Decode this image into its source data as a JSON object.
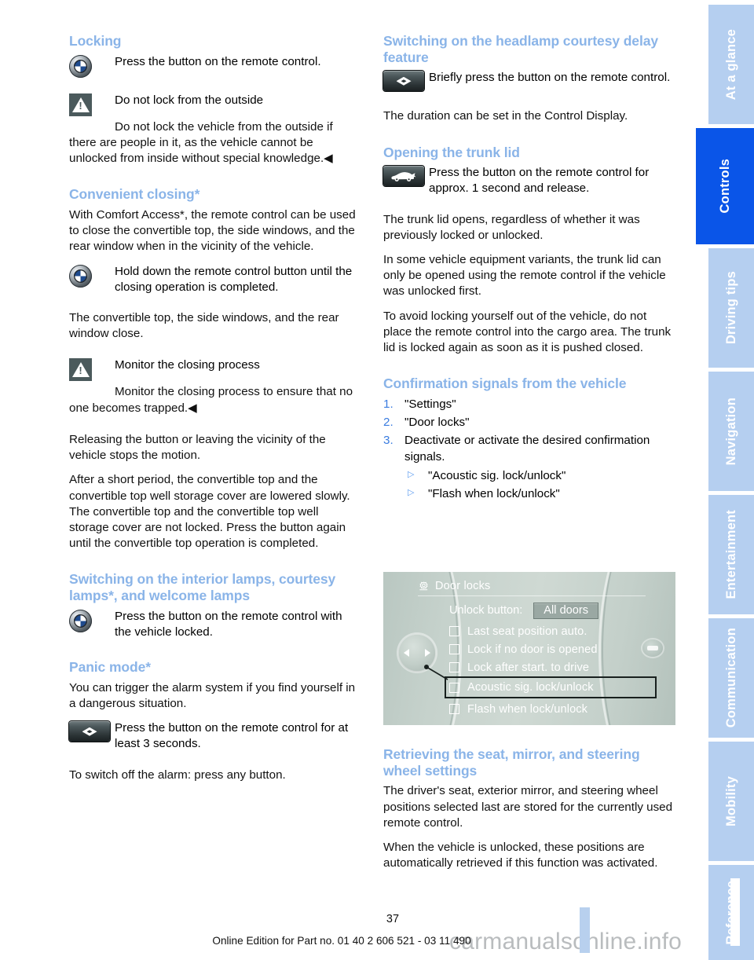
{
  "document": {
    "page_number": "37",
    "footer": "Online Edition for Part no. 01 40 2 606 521 - 03 11 490",
    "watermark": "carmanualsonline.info"
  },
  "colors": {
    "heading_blue": "#8ab4e8",
    "tab_inactive": "#b5cff0",
    "tab_active": "#0a55e8",
    "list_number_blue": "#3b7de0"
  },
  "left_column": {
    "locking": {
      "heading": "Locking",
      "remote_instruction": "Press the button on the remote control.",
      "warning_title": "Do not lock from the outside",
      "warning_body": "Do not lock the vehicle from the outside if there are people in it, as the vehicle cannot be unlocked from inside without special knowledge.◀"
    },
    "convenient_closing": {
      "heading": "Convenient closing*",
      "p1": "With Comfort Access*, the remote control can be used to close the convertible top, the side windows, and the rear window when in the vicinity of the vehicle.",
      "remote_instruction": "Hold down the remote control button until the closing operation is completed.",
      "p2": "The convertible top, the side windows, and the rear window close.",
      "warning_title": "Monitor the closing process",
      "warning_body": "Monitor the closing process to ensure that no one becomes trapped.◀",
      "p3": "Releasing the button or leaving the vicinity of the vehicle stops the motion.",
      "p4": "After a short period, the convertible top and the convertible top well storage cover are lowered slowly. The convertible top and the convertible top well storage cover are not locked. Press the button again until the convertible top operation is completed."
    },
    "interior_lamps": {
      "heading": "Switching on the interior lamps, courtesy lamps*, and welcome lamps",
      "remote_instruction": "Press the button on the remote control with the vehicle locked."
    },
    "panic_mode": {
      "heading": "Panic mode*",
      "p1": "You can trigger the alarm system if you find yourself in a dangerous situation.",
      "key_instruction": "Press the button on the remote control for at least 3 seconds.",
      "p2": "To switch off the alarm: press any button."
    }
  },
  "right_column": {
    "headlamp_courtesy": {
      "heading": "Switching on the headlamp courtesy delay feature",
      "key_instruction": "Briefly press the button on the remote control.",
      "p1": "The duration can be set in the Control Display."
    },
    "trunk_lid": {
      "heading": "Opening the trunk lid",
      "key_instruction": "Press the button on the remote control for approx. 1 second and release.",
      "p1": "The trunk lid opens, regardless of whether it was previously locked or unlocked.",
      "p2": "In some vehicle equipment variants, the trunk lid can only be opened using the remote control if the vehicle was unlocked first.",
      "p3": "To avoid locking yourself out of the vehicle, do not place the remote control into the cargo area. The trunk lid is locked again as soon as it is pushed closed."
    },
    "confirmation_signals": {
      "heading": "Confirmation signals from the vehicle",
      "steps": [
        {
          "num": "1.",
          "text": "\"Settings\""
        },
        {
          "num": "2.",
          "text": "\"Door locks\""
        },
        {
          "num": "3.",
          "text": "Deactivate or activate the desired confirmation signals."
        }
      ],
      "sub_items": [
        "\"Acoustic sig. lock/unlock\"",
        "\"Flash when lock/unlock\""
      ]
    },
    "retrieving_settings": {
      "heading": "Retrieving the seat, mirror, and steering wheel settings",
      "p1": "The driver's seat, exterior mirror, and steering wheel positions selected last are stored for the currently used remote control.",
      "p2": "When the vehicle is unlocked, these positions are automatically retrieved if this function was activated."
    }
  },
  "control_display": {
    "title": "Door locks",
    "unlock_label": "Unlock button:",
    "unlock_value": "All doors",
    "options": [
      {
        "label": "Last seat position auto.",
        "selected": false
      },
      {
        "label": "Lock if no door is opened",
        "selected": false
      },
      {
        "label": "Lock after start. to drive",
        "selected": false
      },
      {
        "label": "Acoustic sig. lock/unlock",
        "selected": true
      },
      {
        "label": "Flash when lock/unlock",
        "selected": false
      }
    ]
  },
  "sidebar": {
    "tabs": [
      {
        "label": "At a glance",
        "active": false
      },
      {
        "label": "Controls",
        "active": true
      },
      {
        "label": "Driving tips",
        "active": false
      },
      {
        "label": "Navigation",
        "active": false
      },
      {
        "label": "Entertainment",
        "active": false
      },
      {
        "label": "Communication",
        "active": false
      },
      {
        "label": "Mobility",
        "active": false
      },
      {
        "label": "Reference",
        "active": false
      }
    ]
  }
}
